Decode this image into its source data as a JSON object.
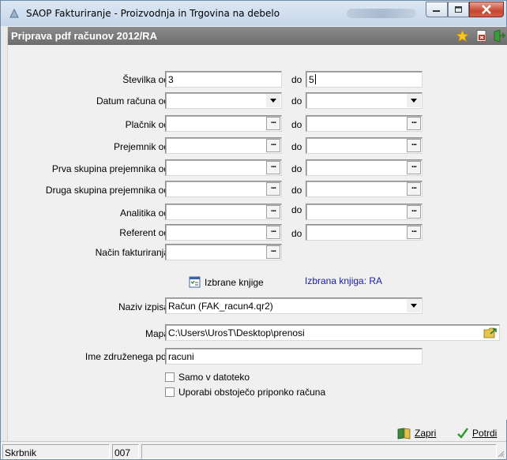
{
  "window": {
    "title": "SAOP Fakturiranje - Proizvodnja in Trgovina na debelo"
  },
  "header": {
    "title": "Priprava pdf računov 2012/RA"
  },
  "form": {
    "stevilka": {
      "label": "Številka od",
      "from": "3",
      "to": "5"
    },
    "datum": {
      "label": "Datum računa od",
      "from": "",
      "to": ""
    },
    "placnik": {
      "label": "Plačnik od",
      "from": "",
      "to": ""
    },
    "prejemnik": {
      "label": "Prejemnik od",
      "from": "",
      "to": ""
    },
    "prva": {
      "label": "Prva skupina prejemnika od",
      "from": "",
      "to": ""
    },
    "druga": {
      "label": "Druga skupina prejemnika od",
      "from": "",
      "to": ""
    },
    "analitika": {
      "label": "Analitika od",
      "from": "",
      "to": ""
    },
    "referent": {
      "label": "Referent od",
      "from": "",
      "to": ""
    },
    "nacin": {
      "label": "Način fakturiranja",
      "value": ""
    },
    "do_label": "do",
    "ellipsis": "...",
    "izbrane_label": "Izbrane knjige",
    "izbrana_knjiga": "Izbrana knjiga: RA",
    "naziv": {
      "label": "Naziv izpisa",
      "value": "Račun  (FAK_racun4.qr2)"
    },
    "mapa": {
      "label": "Mapa",
      "value": "C:\\Users\\UrosT\\Desktop\\prenosi"
    },
    "ime": {
      "label": "Ime združenega pdf",
      "value": "racuni"
    },
    "samo": {
      "label": "Samo v datoteko",
      "checked": false
    },
    "uporabi": {
      "label": "Uporabi obstoječo priponko računa",
      "checked": false
    }
  },
  "buttons": {
    "zapri": "Zapri",
    "potrdi": "Potrdi"
  },
  "statusbar": {
    "user": "Skrbnik",
    "code": "007"
  },
  "colors": {
    "header": "#7a7a7a",
    "link_blue": "#1a1aa8",
    "close_red": "#c74631"
  }
}
